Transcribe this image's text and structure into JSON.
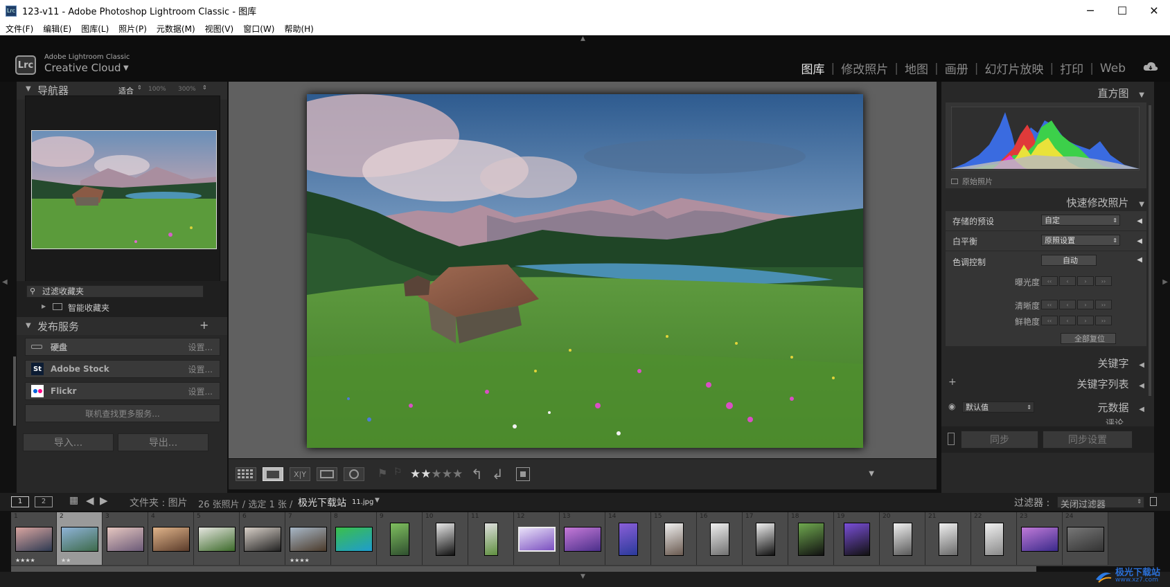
{
  "window": {
    "app_icon": "Lrc",
    "title": "123-v11 - Adobe Photoshop Lightroom Classic - 图库",
    "minimize": "─",
    "maximize": "☐",
    "close": "✕"
  },
  "menu": [
    "文件(F)",
    "编辑(E)",
    "图库(L)",
    "照片(P)",
    "元数据(M)",
    "视图(V)",
    "窗口(W)",
    "帮助(H)"
  ],
  "identity": {
    "badge": "Lrc",
    "small": "Adobe Lightroom Classic",
    "big": "Creative Cloud"
  },
  "modules": [
    "图库",
    "修改照片",
    "地图",
    "画册",
    "幻灯片放映",
    "打印",
    "Web"
  ],
  "navigator": {
    "title": "导航器",
    "zoom_fit": "适合",
    "zoom_100": "100%",
    "zoom_300": "300%"
  },
  "collections": {
    "filter": "过滤收藏夹",
    "smart": "智能收藏夹"
  },
  "publish": {
    "title": "发布服务",
    "add": "+",
    "services": [
      {
        "name": "硬盘",
        "action": "设置..."
      },
      {
        "name": "Adobe Stock",
        "action": "设置..."
      },
      {
        "name": "Flickr",
        "action": "设置..."
      }
    ],
    "find_more": "联机查找更多服务..."
  },
  "left_buttons": {
    "import": "导入...",
    "export": "导出..."
  },
  "histogram": {
    "title": "直方图",
    "original": "原始照片"
  },
  "quick_develop": {
    "title": "快速修改照片",
    "saved_preset_label": "存储的预设",
    "saved_preset_value": "自定",
    "wb_label": "白平衡",
    "wb_value": "原照设置",
    "tone_label": "色调控制",
    "tone_auto": "自动",
    "exposure": "曝光度",
    "clarity": "清晰度",
    "vibrance": "鲜艳度",
    "reset_all": "全部复位"
  },
  "right_sections": {
    "keywords": "关键字",
    "keyword_list": "关键字列表",
    "metadata": "元数据",
    "metadata_preset": "默认值",
    "comments": "评论"
  },
  "sync": {
    "sync": "同步",
    "sync_settings": "同步设置"
  },
  "toolbar": {
    "rating": 2,
    "max_rating": 5
  },
  "filmbar": {
    "screen1": "1",
    "screen2": "2",
    "folder_label": "文件夹 : 图片",
    "count": "26 张照片 / 选定 1 张 /",
    "filename": "极光下载站",
    "filename_suffix": "11.jpg",
    "filter_label": "过滤器 :",
    "filter_value": "关闭过滤器"
  },
  "filmstrip": [
    {
      "num": "1",
      "stars": "★★★★"
    },
    {
      "num": "2",
      "stars": "★★"
    },
    {
      "num": "3",
      "stars": ""
    },
    {
      "num": "4",
      "stars": ""
    },
    {
      "num": "5",
      "stars": ""
    },
    {
      "num": "6",
      "stars": ""
    },
    {
      "num": "7",
      "stars": "★★★★"
    },
    {
      "num": "8",
      "stars": ""
    },
    {
      "num": "9",
      "stars": ""
    },
    {
      "num": "10",
      "stars": ""
    },
    {
      "num": "11",
      "stars": ""
    },
    {
      "num": "12",
      "stars": ""
    },
    {
      "num": "13",
      "stars": ""
    },
    {
      "num": "14",
      "stars": ""
    },
    {
      "num": "15",
      "stars": ""
    },
    {
      "num": "16",
      "stars": ""
    },
    {
      "num": "17",
      "stars": ""
    },
    {
      "num": "18",
      "stars": ""
    },
    {
      "num": "19",
      "stars": ""
    },
    {
      "num": "20",
      "stars": ""
    },
    {
      "num": "21",
      "stars": ""
    },
    {
      "num": "22",
      "stars": ""
    },
    {
      "num": "23",
      "stars": ""
    },
    {
      "num": "24",
      "stars": ""
    }
  ],
  "watermark": {
    "name": "极光下载站",
    "url": "www.xz7.com"
  },
  "colors": {
    "accent": "#e8e8e8",
    "panel": "#282828",
    "center_bg": "#606060"
  }
}
